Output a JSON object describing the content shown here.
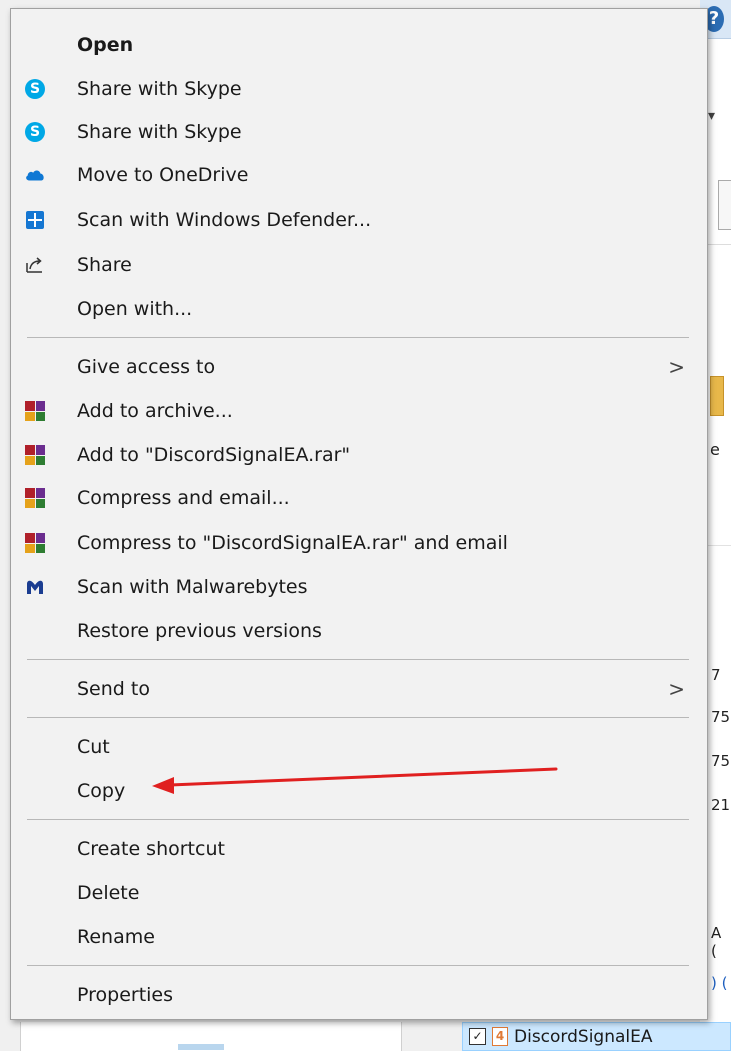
{
  "background": {
    "help_glyph": "?",
    "fragments": [
      "e",
      "∣",
      "7",
      "75",
      "75",
      "21",
      "A (",
      ") ("
    ],
    "selected_item": {
      "checked": "✓",
      "badge": "4",
      "name": "DiscordSignalEA"
    }
  },
  "menu": {
    "items": [
      {
        "label": "Open",
        "bold": true,
        "icon": "none"
      },
      {
        "label": "Share with Skype",
        "icon": "skype-icon"
      },
      {
        "label": "Share with Skype",
        "icon": "skype-icon"
      },
      {
        "label": "Move to OneDrive",
        "icon": "onedrive-icon"
      },
      {
        "label": "Scan with Windows Defender...",
        "icon": "defender-icon"
      },
      {
        "label": "Share",
        "icon": "share-icon"
      },
      {
        "label": "Open with...",
        "icon": "none"
      },
      {
        "label": "Give access to",
        "icon": "none",
        "submenu": true
      },
      {
        "label": "Add to archive...",
        "icon": "winrar-icon"
      },
      {
        "label": "Add to \"DiscordSignalEA.rar\"",
        "icon": "winrar-icon"
      },
      {
        "label": "Compress and email...",
        "icon": "winrar-icon"
      },
      {
        "label": "Compress to \"DiscordSignalEA.rar\" and email",
        "icon": "winrar-icon"
      },
      {
        "label": "Scan with Malwarebytes",
        "icon": "malwarebytes-icon"
      },
      {
        "label": "Restore previous versions",
        "icon": "none"
      },
      {
        "label": "Send to",
        "icon": "none",
        "submenu": true
      },
      {
        "label": "Cut",
        "icon": "none"
      },
      {
        "label": "Copy",
        "icon": "none"
      },
      {
        "label": "Create shortcut",
        "icon": "none"
      },
      {
        "label": "Delete",
        "icon": "none"
      },
      {
        "label": "Rename",
        "icon": "none"
      },
      {
        "label": "Properties",
        "icon": "none"
      }
    ],
    "submenu_glyph": ">"
  },
  "colors": {
    "annotation_arrow": "#e02020",
    "selection": "#cce8ff"
  }
}
